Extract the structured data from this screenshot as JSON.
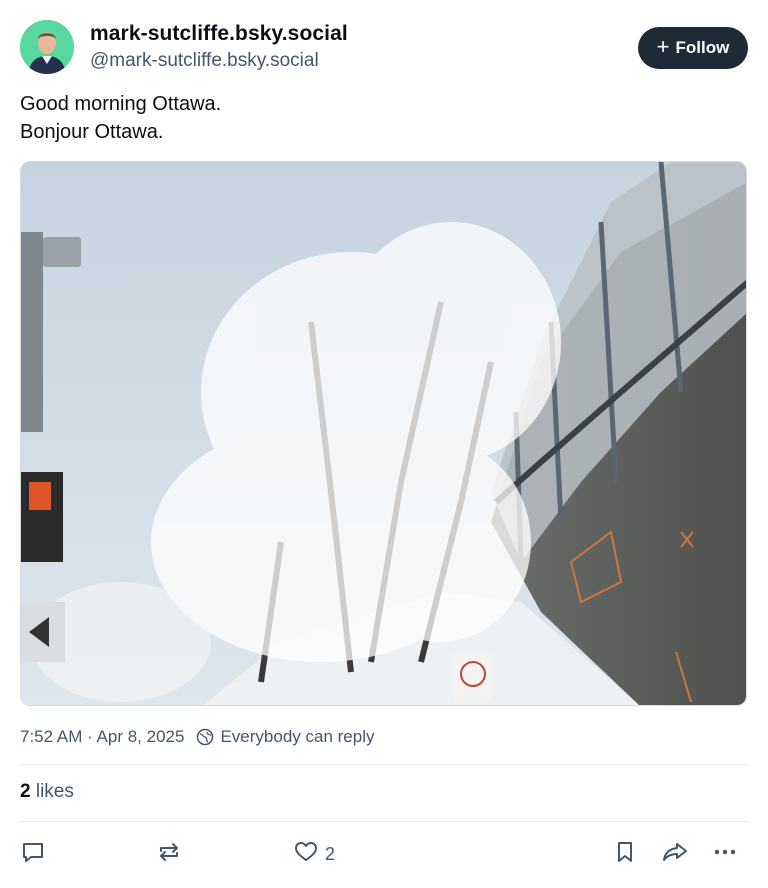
{
  "author": {
    "display_name": "mark-sutcliffe.bsky.social",
    "handle": "@mark-sutcliffe.bsky.social",
    "avatar_color": "#59d7a0"
  },
  "follow_button": {
    "label": "Follow",
    "icon": "plus-icon"
  },
  "post": {
    "lines": [
      "Good morning Ottawa.",
      "Bonjour Ottawa."
    ]
  },
  "meta": {
    "timestamp": "7:52 AM · Apr 8, 2025",
    "reply_setting": "Everybody can reply"
  },
  "likes": {
    "count": "2",
    "label": "likes"
  },
  "actions": {
    "reply_icon": "comment-icon",
    "repost_icon": "repost-icon",
    "like_icon": "heart-icon",
    "like_count": "2",
    "bookmark_icon": "bookmark-icon",
    "share_icon": "share-icon",
    "more_icon": "ellipsis-icon"
  },
  "colors": {
    "text": "#0b0f14",
    "muted": "#42576c",
    "button_bg": "#1f2a37"
  }
}
